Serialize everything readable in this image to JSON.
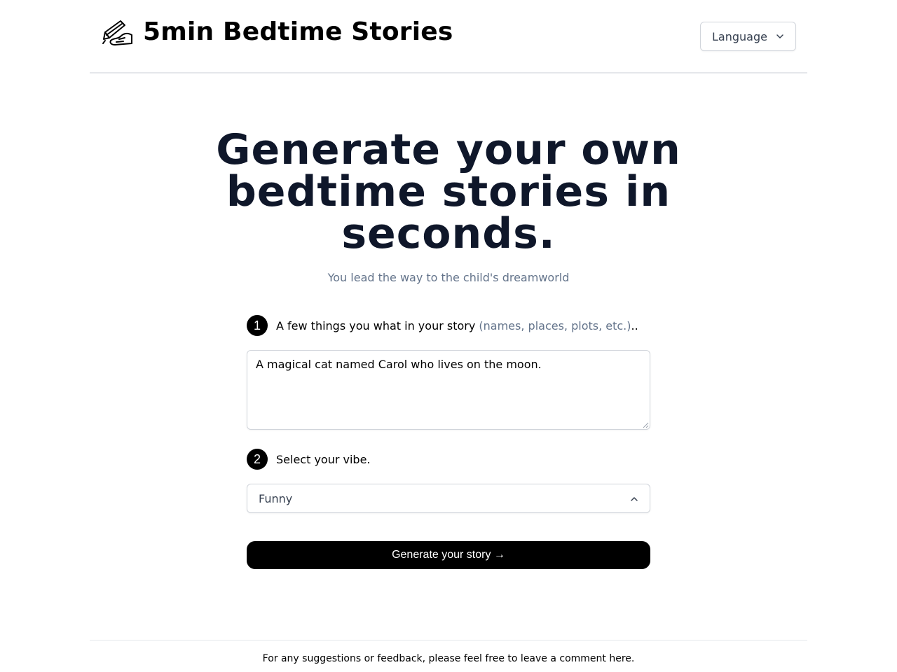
{
  "header": {
    "brand": "5min Bedtime Stories",
    "logo_icon": "hand-writing-icon",
    "language_label": "Language"
  },
  "hero": {
    "line1": "Generate your own",
    "line2": "bedtime stories in",
    "line3": "seconds.",
    "subtitle": "You lead the way to the child's dreamworld"
  },
  "step1": {
    "number": "1",
    "label": "A few things you what in your story ",
    "hint": "(names, places, plots, etc.)",
    "suffix": "..",
    "input_value": "A magical cat named Carol who lives on the moon."
  },
  "step2": {
    "number": "2",
    "label": "Select your vibe.",
    "selected": "Funny"
  },
  "generate_label": "Generate your story →",
  "footer": {
    "text": "For any suggestions or feedback, please feel free to leave a comment here."
  }
}
